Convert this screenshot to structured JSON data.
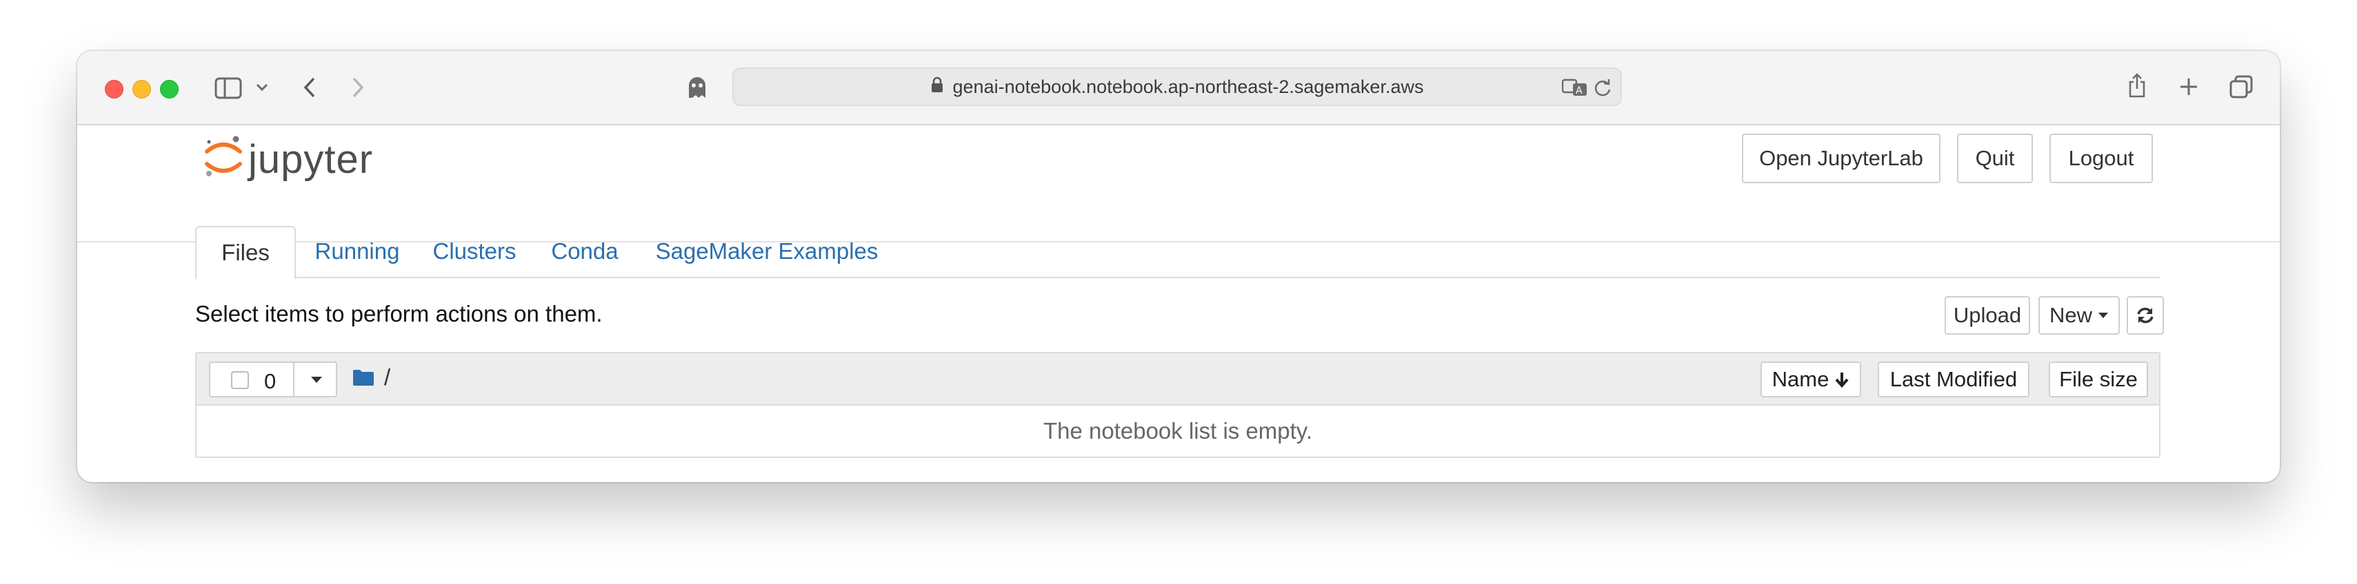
{
  "browser": {
    "url": "genai-notebook.notebook.ap-northeast-2.sagemaker.aws",
    "icons": [
      "sidebar-icon",
      "chevron-down-icon",
      "back-icon",
      "forward-icon",
      "privacy-ghost-icon",
      "lock-icon",
      "translate-icon",
      "reload-icon",
      "share-icon",
      "plus-icon",
      "tabs-icon"
    ]
  },
  "header": {
    "logo_text": "jupyter",
    "open_jupyterlab": "Open JupyterLab",
    "quit": "Quit",
    "logout": "Logout"
  },
  "tabs": [
    {
      "label": "Files",
      "active": true
    },
    {
      "label": "Running",
      "active": false
    },
    {
      "label": "Clusters",
      "active": false
    },
    {
      "label": "Conda",
      "active": false
    },
    {
      "label": "SageMaker Examples",
      "active": false
    }
  ],
  "actions": {
    "hint": "Select items to perform actions on them.",
    "upload": "Upload",
    "new": "New"
  },
  "list": {
    "selected_count": "0",
    "path": "/",
    "columns": {
      "name": "Name",
      "last_modified": "Last Modified",
      "file_size": "File size"
    },
    "empty_message": "The notebook list is empty."
  },
  "colors": {
    "link": "#2a6fb0",
    "jupyter_orange": "#f37726",
    "folder": "#2a6fb0"
  }
}
